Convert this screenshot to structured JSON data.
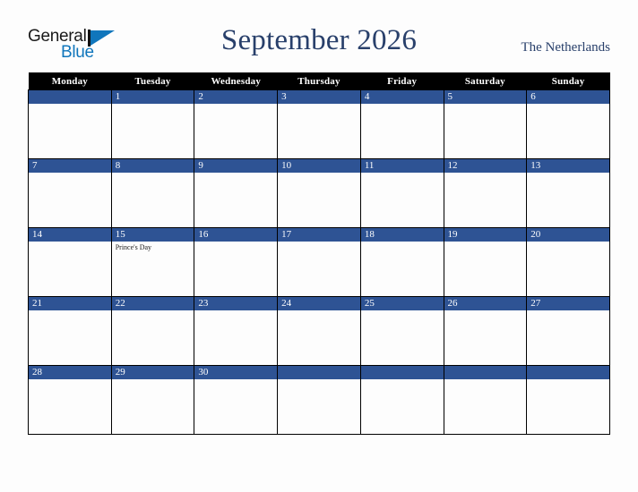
{
  "brand": {
    "name_part1": "General",
    "name_part2": "Blue",
    "logo_icon": "triangle-flag-icon",
    "color_dark": "#1a1a1a",
    "color_blue": "#1076bc"
  },
  "header": {
    "month_title": "September 2026",
    "country": "The Netherlands",
    "title_color": "#29406b"
  },
  "calendar": {
    "weekday_headers": [
      "Monday",
      "Tuesday",
      "Wednesday",
      "Thursday",
      "Friday",
      "Saturday",
      "Sunday"
    ],
    "header_bg": "#000000",
    "header_text_color": "#ffffff",
    "daybar_bg": "#2e5394",
    "daybar_text_color": "#ffffff",
    "cell_bg": "#fdfdfd",
    "border_color": "#000000",
    "weeks": [
      [
        {
          "date": "",
          "event": ""
        },
        {
          "date": "1",
          "event": ""
        },
        {
          "date": "2",
          "event": ""
        },
        {
          "date": "3",
          "event": ""
        },
        {
          "date": "4",
          "event": ""
        },
        {
          "date": "5",
          "event": ""
        },
        {
          "date": "6",
          "event": ""
        }
      ],
      [
        {
          "date": "7",
          "event": ""
        },
        {
          "date": "8",
          "event": ""
        },
        {
          "date": "9",
          "event": ""
        },
        {
          "date": "10",
          "event": ""
        },
        {
          "date": "11",
          "event": ""
        },
        {
          "date": "12",
          "event": ""
        },
        {
          "date": "13",
          "event": ""
        }
      ],
      [
        {
          "date": "14",
          "event": ""
        },
        {
          "date": "15",
          "event": "Prince's Day"
        },
        {
          "date": "16",
          "event": ""
        },
        {
          "date": "17",
          "event": ""
        },
        {
          "date": "18",
          "event": ""
        },
        {
          "date": "19",
          "event": ""
        },
        {
          "date": "20",
          "event": ""
        }
      ],
      [
        {
          "date": "21",
          "event": ""
        },
        {
          "date": "22",
          "event": ""
        },
        {
          "date": "23",
          "event": ""
        },
        {
          "date": "24",
          "event": ""
        },
        {
          "date": "25",
          "event": ""
        },
        {
          "date": "26",
          "event": ""
        },
        {
          "date": "27",
          "event": ""
        }
      ],
      [
        {
          "date": "28",
          "event": ""
        },
        {
          "date": "29",
          "event": ""
        },
        {
          "date": "30",
          "event": ""
        },
        {
          "date": "",
          "event": ""
        },
        {
          "date": "",
          "event": ""
        },
        {
          "date": "",
          "event": ""
        },
        {
          "date": "",
          "event": ""
        }
      ]
    ]
  }
}
